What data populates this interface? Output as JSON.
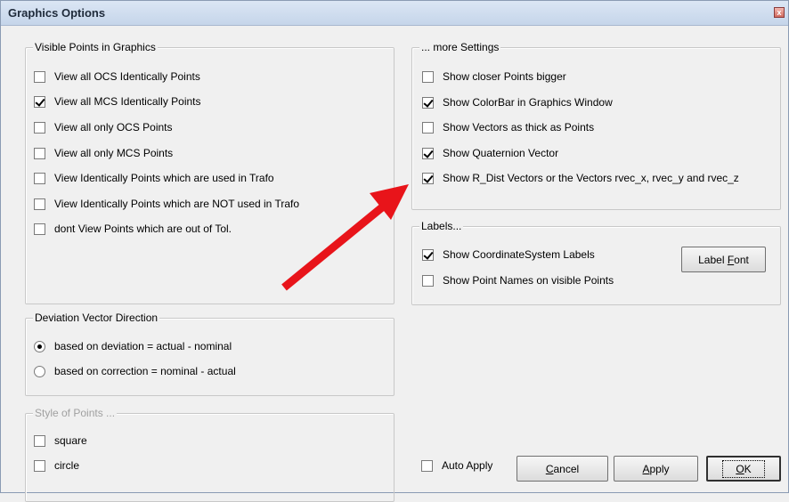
{
  "window": {
    "title": "Graphics Options",
    "close_glyph": "x"
  },
  "visible_points": {
    "legend": "Visible Points in Graphics",
    "items": [
      {
        "label": "View all OCS Identically Points",
        "checked": false
      },
      {
        "label": "View all MCS Identically Points",
        "checked": true
      },
      {
        "label": "View all only OCS Points",
        "checked": false
      },
      {
        "label": "View all only MCS Points",
        "checked": false
      },
      {
        "label": "View Identically Points which are used in Trafo",
        "checked": false
      },
      {
        "label": "View Identically Points which are NOT used in Trafo",
        "checked": false
      },
      {
        "label": "dont View Points which are out of Tol.",
        "checked": false
      }
    ]
  },
  "more_settings": {
    "legend": "... more Settings",
    "items": [
      {
        "label": "Show closer Points bigger",
        "checked": false
      },
      {
        "label": "Show ColorBar in Graphics Window",
        "checked": true
      },
      {
        "label": "Show Vectors as thick as Points",
        "checked": false
      },
      {
        "label": "Show Quaternion Vector",
        "checked": true
      },
      {
        "label": "Show R_Dist Vectors or the Vectors rvec_x, rvec_y and rvec_z",
        "checked": true
      }
    ]
  },
  "labels": {
    "legend": "Labels...",
    "items": [
      {
        "label": "Show CoordinateSystem Labels",
        "checked": true
      },
      {
        "label": "Show Point Names on visible Points",
        "checked": false
      }
    ],
    "label_font_button": {
      "pre": "Label ",
      "accel": "F",
      "post": "ont"
    }
  },
  "deviation": {
    "legend": "Deviation Vector Direction",
    "options": [
      {
        "label": "based on deviation = actual - nominal",
        "selected": true
      },
      {
        "label": "based on correction = nominal - actual",
        "selected": false
      }
    ]
  },
  "style_points": {
    "legend": "Style of Points ...",
    "items": [
      {
        "label": "square",
        "checked": false
      },
      {
        "label": "circle",
        "checked": false
      }
    ]
  },
  "footer": {
    "auto_apply": {
      "label": "Auto Apply",
      "checked": false
    },
    "cancel": {
      "accel": "C",
      "post": "ancel"
    },
    "apply": {
      "accel": "A",
      "post": "pply"
    },
    "ok": {
      "accel": "O",
      "post": "K"
    }
  },
  "colors": {
    "annotation_arrow": "#e8141a"
  },
  "icons": {
    "annotation": "arrow-icon",
    "close": "close-icon"
  }
}
